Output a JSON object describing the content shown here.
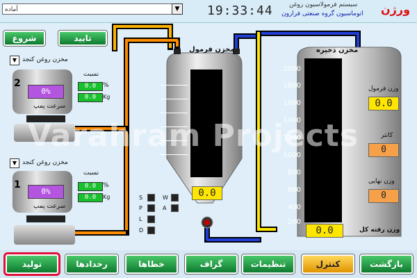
{
  "header": {
    "status_text": "آماده",
    "clock": "19:33:44",
    "brand": "ورژن",
    "system_line1": "سیستم فرمولاسیون روغن",
    "system_line2": "اتوماسیون  گروه صنعتی فرارون"
  },
  "top_buttons": {
    "start": "شروع",
    "confirm": "تایید"
  },
  "mixer2": {
    "select_label": "مخزن روغن کنجد",
    "number": "2",
    "ratio_label": "نسبت",
    "percent_display": "0%",
    "ratio_value": "0.0",
    "ratio_unit": "%",
    "weight_value": "0.0",
    "weight_unit": "Kg",
    "pump_label": "سرعت پمپ"
  },
  "mixer1": {
    "select_label": "مخزن روغن کنجد",
    "number": "1",
    "ratio_label": "نسبت",
    "percent_display": "0%",
    "ratio_value": "0.0",
    "ratio_unit": "%",
    "weight_value": "0.0",
    "weight_unit": "Kg",
    "pump_label": "سرعت پمپ"
  },
  "formula_tank": {
    "label": "مخزن فرمول",
    "value": "0.0"
  },
  "storage_tank": {
    "label": "مخزن ذخیره",
    "scale": [
      "2000",
      "1800",
      "1600",
      "1400",
      "1200",
      "1000",
      "800",
      "600",
      "400",
      "200"
    ],
    "total_label": "وزن رفته کل",
    "total_value": "0.0"
  },
  "right_readouts": {
    "formula_weight_label": "وزن فرمول",
    "formula_weight_value": "0.0",
    "counter_label": "کانتر",
    "counter_value": "0",
    "final_weight_label": "وزن نهایی",
    "final_weight_value": "0"
  },
  "indicators": {
    "left": [
      "S",
      "P",
      "L",
      "D"
    ],
    "right": [
      "W",
      "A"
    ]
  },
  "watermark": "Varahram Projects",
  "bottom_nav": [
    "تولید",
    "رخدادها",
    "خطاها",
    "گراف",
    "تنظیمات",
    "کنترل",
    "بازگشت"
  ],
  "colors": {
    "green_button": "#0d7a2f",
    "active_button": "#ffc125",
    "production_outline": "#e0103a",
    "pipe_orange": "#ff8c00",
    "pipe_blue": "#1f3fd6"
  }
}
